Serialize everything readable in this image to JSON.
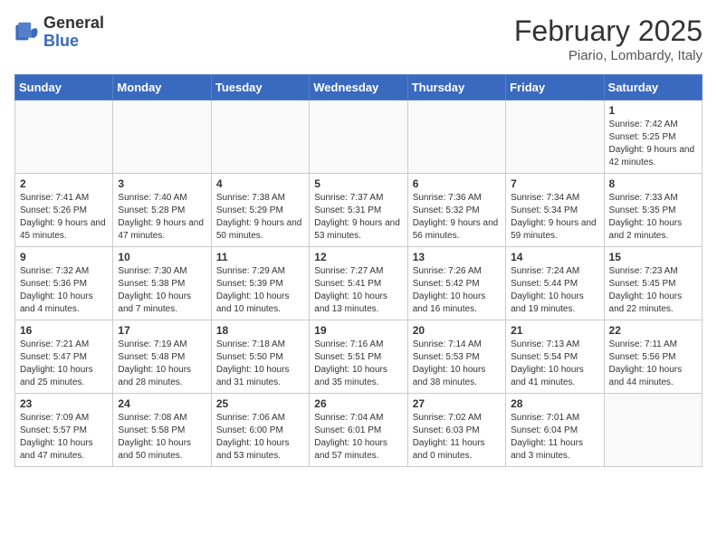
{
  "logo": {
    "general": "General",
    "blue": "Blue"
  },
  "title": "February 2025",
  "location": "Piario, Lombardy, Italy",
  "days_of_week": [
    "Sunday",
    "Monday",
    "Tuesday",
    "Wednesday",
    "Thursday",
    "Friday",
    "Saturday"
  ],
  "weeks": [
    [
      {
        "day": "",
        "info": ""
      },
      {
        "day": "",
        "info": ""
      },
      {
        "day": "",
        "info": ""
      },
      {
        "day": "",
        "info": ""
      },
      {
        "day": "",
        "info": ""
      },
      {
        "day": "",
        "info": ""
      },
      {
        "day": "1",
        "info": "Sunrise: 7:42 AM\nSunset: 5:25 PM\nDaylight: 9 hours and 42 minutes."
      }
    ],
    [
      {
        "day": "2",
        "info": "Sunrise: 7:41 AM\nSunset: 5:26 PM\nDaylight: 9 hours and 45 minutes."
      },
      {
        "day": "3",
        "info": "Sunrise: 7:40 AM\nSunset: 5:28 PM\nDaylight: 9 hours and 47 minutes."
      },
      {
        "day": "4",
        "info": "Sunrise: 7:38 AM\nSunset: 5:29 PM\nDaylight: 9 hours and 50 minutes."
      },
      {
        "day": "5",
        "info": "Sunrise: 7:37 AM\nSunset: 5:31 PM\nDaylight: 9 hours and 53 minutes."
      },
      {
        "day": "6",
        "info": "Sunrise: 7:36 AM\nSunset: 5:32 PM\nDaylight: 9 hours and 56 minutes."
      },
      {
        "day": "7",
        "info": "Sunrise: 7:34 AM\nSunset: 5:34 PM\nDaylight: 9 hours and 59 minutes."
      },
      {
        "day": "8",
        "info": "Sunrise: 7:33 AM\nSunset: 5:35 PM\nDaylight: 10 hours and 2 minutes."
      }
    ],
    [
      {
        "day": "9",
        "info": "Sunrise: 7:32 AM\nSunset: 5:36 PM\nDaylight: 10 hours and 4 minutes."
      },
      {
        "day": "10",
        "info": "Sunrise: 7:30 AM\nSunset: 5:38 PM\nDaylight: 10 hours and 7 minutes."
      },
      {
        "day": "11",
        "info": "Sunrise: 7:29 AM\nSunset: 5:39 PM\nDaylight: 10 hours and 10 minutes."
      },
      {
        "day": "12",
        "info": "Sunrise: 7:27 AM\nSunset: 5:41 PM\nDaylight: 10 hours and 13 minutes."
      },
      {
        "day": "13",
        "info": "Sunrise: 7:26 AM\nSunset: 5:42 PM\nDaylight: 10 hours and 16 minutes."
      },
      {
        "day": "14",
        "info": "Sunrise: 7:24 AM\nSunset: 5:44 PM\nDaylight: 10 hours and 19 minutes."
      },
      {
        "day": "15",
        "info": "Sunrise: 7:23 AM\nSunset: 5:45 PM\nDaylight: 10 hours and 22 minutes."
      }
    ],
    [
      {
        "day": "16",
        "info": "Sunrise: 7:21 AM\nSunset: 5:47 PM\nDaylight: 10 hours and 25 minutes."
      },
      {
        "day": "17",
        "info": "Sunrise: 7:19 AM\nSunset: 5:48 PM\nDaylight: 10 hours and 28 minutes."
      },
      {
        "day": "18",
        "info": "Sunrise: 7:18 AM\nSunset: 5:50 PM\nDaylight: 10 hours and 31 minutes."
      },
      {
        "day": "19",
        "info": "Sunrise: 7:16 AM\nSunset: 5:51 PM\nDaylight: 10 hours and 35 minutes."
      },
      {
        "day": "20",
        "info": "Sunrise: 7:14 AM\nSunset: 5:53 PM\nDaylight: 10 hours and 38 minutes."
      },
      {
        "day": "21",
        "info": "Sunrise: 7:13 AM\nSunset: 5:54 PM\nDaylight: 10 hours and 41 minutes."
      },
      {
        "day": "22",
        "info": "Sunrise: 7:11 AM\nSunset: 5:56 PM\nDaylight: 10 hours and 44 minutes."
      }
    ],
    [
      {
        "day": "23",
        "info": "Sunrise: 7:09 AM\nSunset: 5:57 PM\nDaylight: 10 hours and 47 minutes."
      },
      {
        "day": "24",
        "info": "Sunrise: 7:08 AM\nSunset: 5:58 PM\nDaylight: 10 hours and 50 minutes."
      },
      {
        "day": "25",
        "info": "Sunrise: 7:06 AM\nSunset: 6:00 PM\nDaylight: 10 hours and 53 minutes."
      },
      {
        "day": "26",
        "info": "Sunrise: 7:04 AM\nSunset: 6:01 PM\nDaylight: 10 hours and 57 minutes."
      },
      {
        "day": "27",
        "info": "Sunrise: 7:02 AM\nSunset: 6:03 PM\nDaylight: 11 hours and 0 minutes."
      },
      {
        "day": "28",
        "info": "Sunrise: 7:01 AM\nSunset: 6:04 PM\nDaylight: 11 hours and 3 minutes."
      },
      {
        "day": "",
        "info": ""
      }
    ]
  ]
}
